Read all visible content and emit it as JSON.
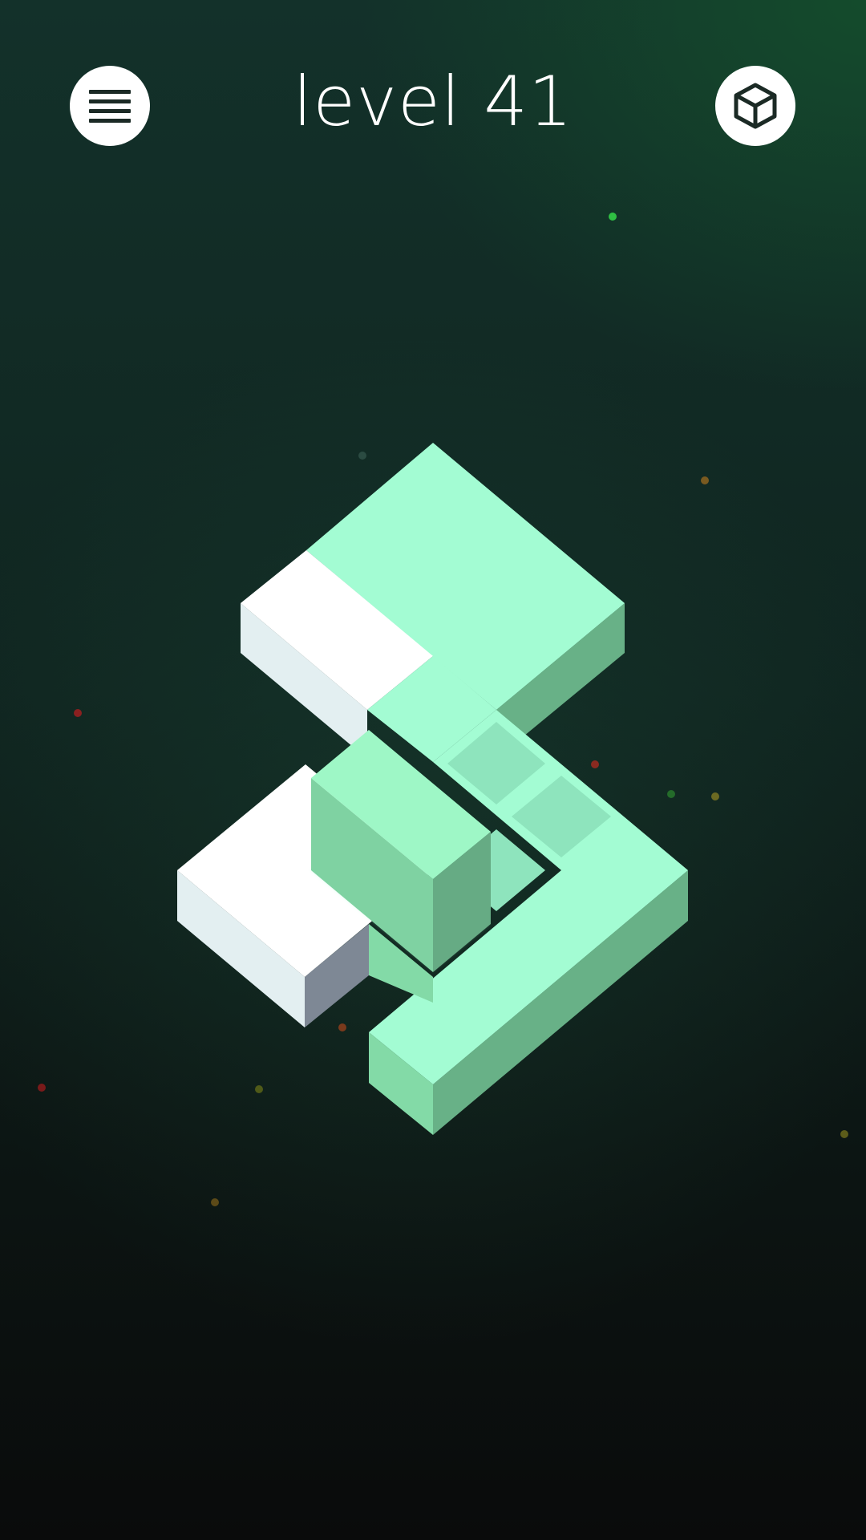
{
  "header": {
    "level_title": "level 41",
    "menu_icon": "hamburger-menu-icon",
    "cube_icon": "cube-icon"
  },
  "palette": {
    "mint_top": "#a3fcd3",
    "mint_left": "#83daa7",
    "mint_right": "#68b187",
    "white_top": "#ffffff",
    "white_left": "#e3eff1",
    "white_right": "#7e8895",
    "button_bg": "#ffffff",
    "icon_dark": "#1b2a25"
  }
}
